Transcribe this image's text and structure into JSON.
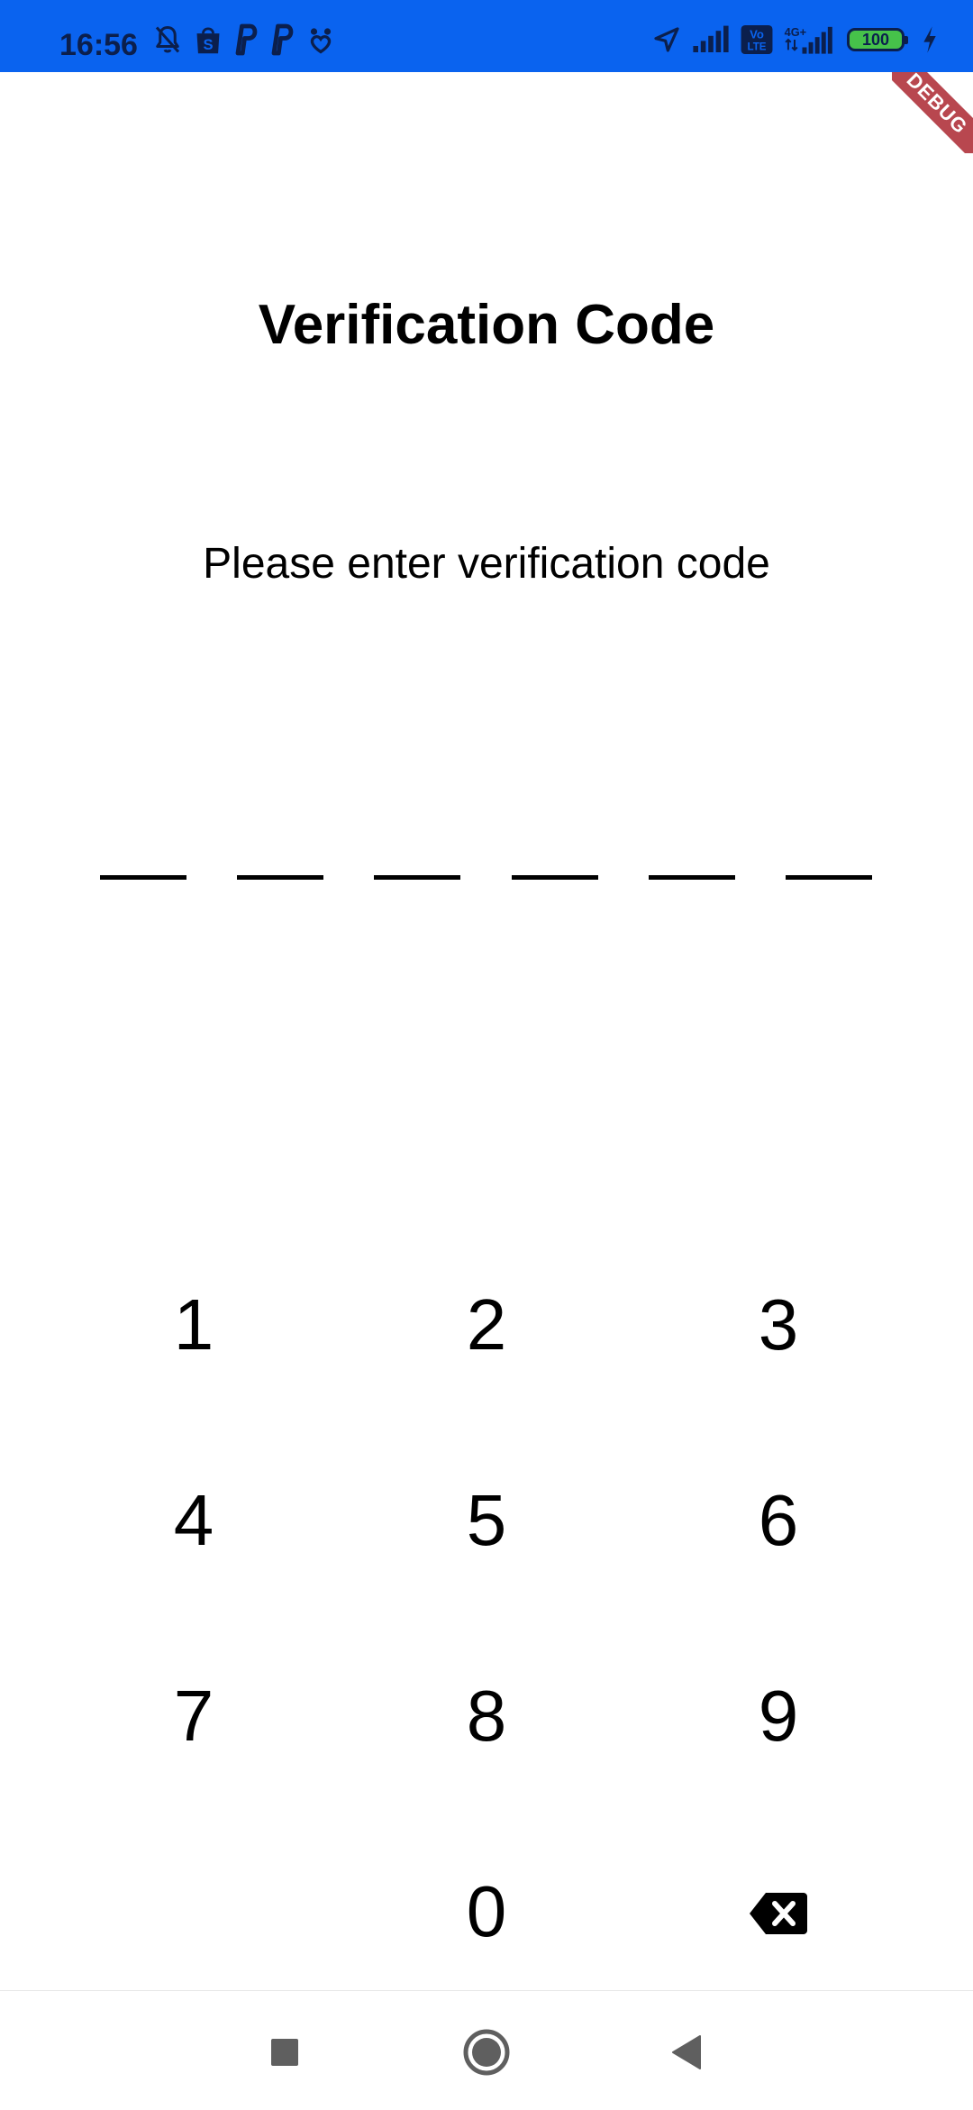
{
  "status_bar": {
    "time": "16:56",
    "battery_level": "100",
    "left_icons": [
      "bell-off-icon",
      "shopee-icon",
      "paypal-icon",
      "paypal-icon",
      "dog-paw-icon"
    ],
    "right_icons": [
      "location-arrow-icon",
      "signal-bars-icon",
      "volte-icon",
      "4g-signal-icon",
      "battery-icon",
      "charging-icon"
    ],
    "volte_label": "Vo LTE",
    "network_label": "4G+",
    "background_color": "#0a63ef"
  },
  "debug_ribbon": {
    "label": "DEBUG",
    "color": "#b8474f"
  },
  "screen": {
    "title": "Verification Code",
    "subtitle": "Please enter verification code",
    "code_slots": [
      "",
      "",
      "",
      "",
      "",
      ""
    ]
  },
  "keypad": {
    "keys": [
      "1",
      "2",
      "3",
      "4",
      "5",
      "6",
      "7",
      "8",
      "9",
      "0"
    ],
    "backspace_icon": "backspace-icon"
  },
  "nav_bar": {
    "buttons": [
      "recents-square-icon",
      "home-circle-icon",
      "back-triangle-icon"
    ]
  }
}
